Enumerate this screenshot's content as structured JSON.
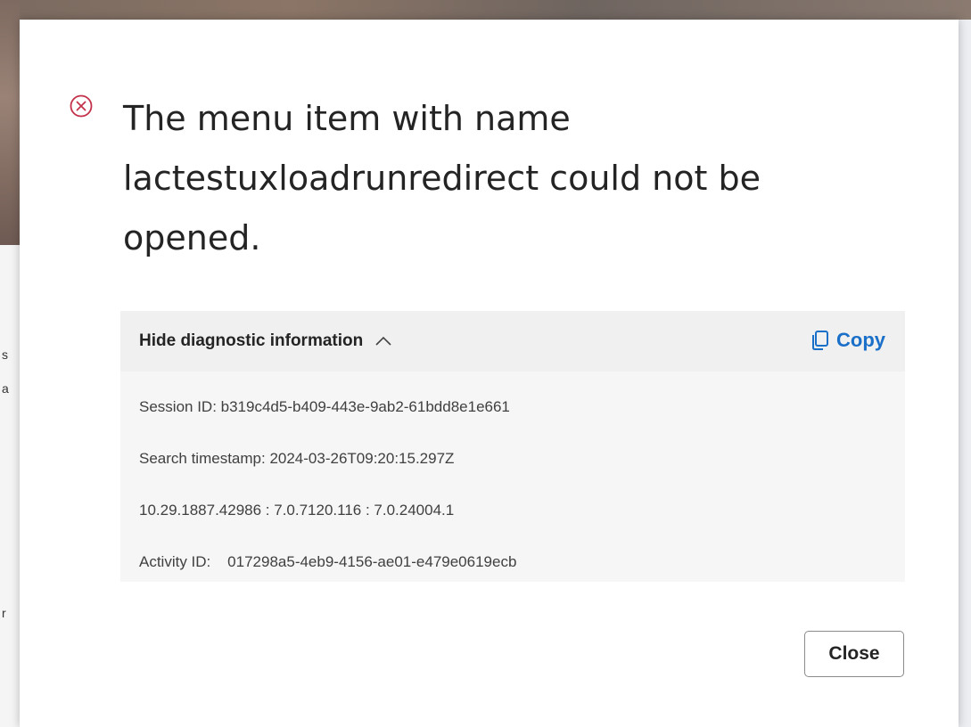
{
  "dialog": {
    "title": "The menu item with name lactestuxloadrunredirect could not be opened.",
    "diagnostics": {
      "toggle_label": "Hide diagnostic information",
      "copy_label": "Copy",
      "lines": [
        "Session ID: b319c4d5-b409-443e-9ab2-61bdd8e1e661",
        "Search timestamp: 2024-03-26T09:20:15.297Z",
        "10.29.1887.42986 : 7.0.7120.116 : 7.0.24004.1",
        "Activity ID:    017298a5-4eb9-4156-ae01-e479e0619ecb"
      ]
    },
    "close_label": "Close"
  },
  "background": {
    "left_fragments": [
      "s",
      "a",
      "r"
    ]
  },
  "colors": {
    "error_red": "#c4314b",
    "link_blue": "#1a6fc9",
    "text": "#242424"
  },
  "icons": {
    "error": "error-circle-x-icon",
    "chevron": "chevron-up-icon",
    "copy": "copy-icon"
  }
}
